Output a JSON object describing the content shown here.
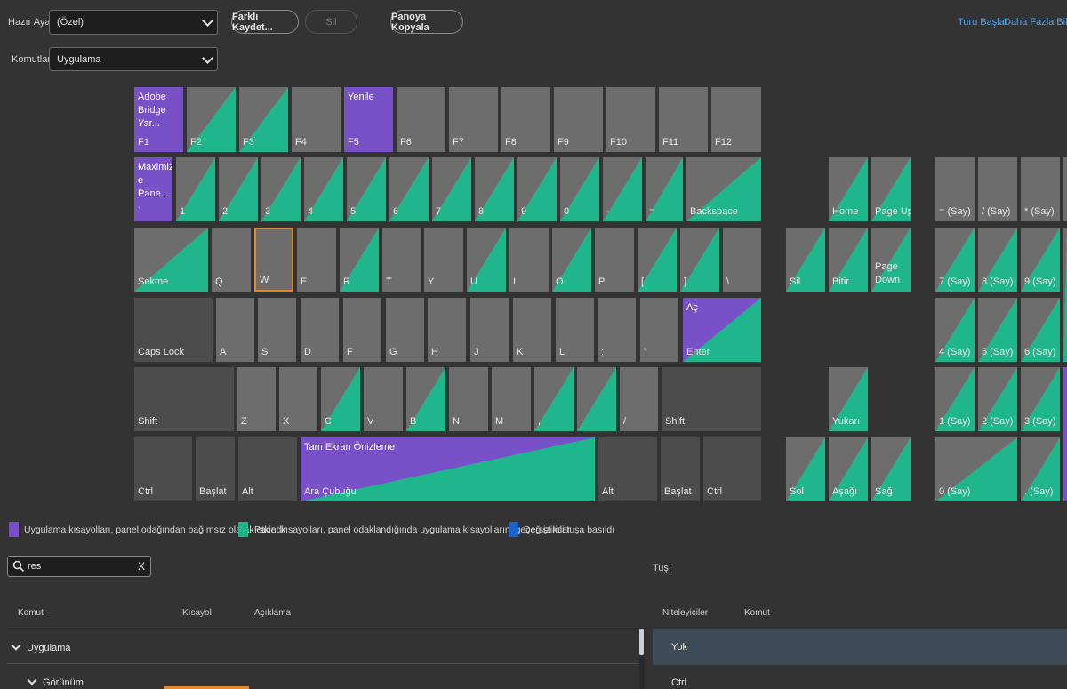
{
  "toolbar": {
    "preset_label": "Hazır Ayar:",
    "preset_value": "(Özel)",
    "save_as_label": "Farklı Kaydet...",
    "delete_label": "Sil",
    "copy_clipboard_label": "Panoya Kopyala",
    "commands_label": "Komutlar:",
    "commands_value": "Uygulama",
    "start_tour_label": "Turu Başlat",
    "more_info_label": "Daha Fazla Bilgi"
  },
  "keyboard": {
    "colors": {
      "app": "#7850c8",
      "panel": "#1fb68b",
      "modifier": "#1e64c8",
      "key": "#6d6d6d",
      "selected_border": "#e08a2e"
    },
    "keys": [
      {
        "id": "f1",
        "label": "F1",
        "top_label": "Adobe\nBridge Yar...",
        "type": "app"
      },
      {
        "id": "f2",
        "label": "F2",
        "type": "panel"
      },
      {
        "id": "f3",
        "label": "F3",
        "type": "panel"
      },
      {
        "id": "f4",
        "label": "F4",
        "type": "none"
      },
      {
        "id": "f5",
        "label": "F5",
        "top_label": "Yenile",
        "type": "app"
      },
      {
        "id": "f6",
        "label": "F6",
        "type": "none"
      },
      {
        "id": "f7",
        "label": "F7",
        "type": "none"
      },
      {
        "id": "f8",
        "label": "F8",
        "type": "none"
      },
      {
        "id": "f9",
        "label": "F9",
        "type": "none"
      },
      {
        "id": "f10",
        "label": "F10",
        "type": "none"
      },
      {
        "id": "f11",
        "label": "F11",
        "type": "none"
      },
      {
        "id": "f12",
        "label": "F12",
        "type": "none"
      },
      {
        "id": "backtick",
        "label": "`",
        "top_label": "Maximiz\ne Pane...",
        "type": "app"
      },
      {
        "id": "d1",
        "label": "1",
        "type": "panel"
      },
      {
        "id": "d2",
        "label": "2",
        "type": "panel"
      },
      {
        "id": "d3",
        "label": "3",
        "type": "panel"
      },
      {
        "id": "d4",
        "label": "4",
        "type": "panel"
      },
      {
        "id": "d5",
        "label": "5",
        "type": "panel"
      },
      {
        "id": "d6",
        "label": "6",
        "type": "panel"
      },
      {
        "id": "d7",
        "label": "7",
        "type": "panel"
      },
      {
        "id": "d8",
        "label": "8",
        "type": "panel"
      },
      {
        "id": "d9",
        "label": "9",
        "type": "panel"
      },
      {
        "id": "d0",
        "label": "0",
        "type": "panel"
      },
      {
        "id": "minus",
        "label": "-",
        "type": "panel"
      },
      {
        "id": "equals",
        "label": "=",
        "type": "panel"
      },
      {
        "id": "backspace",
        "label": "Backspace",
        "type": "panel"
      },
      {
        "id": "tab",
        "label": "Sekme",
        "type": "panel"
      },
      {
        "id": "q",
        "label": "Q",
        "type": "none"
      },
      {
        "id": "w",
        "label": "W",
        "type": "none",
        "selected": true
      },
      {
        "id": "e",
        "label": "E",
        "type": "none"
      },
      {
        "id": "r",
        "label": "R",
        "type": "panel"
      },
      {
        "id": "t",
        "label": "T",
        "type": "none"
      },
      {
        "id": "y",
        "label": "Y",
        "type": "none"
      },
      {
        "id": "u",
        "label": "U",
        "type": "panel"
      },
      {
        "id": "i",
        "label": "I",
        "type": "none"
      },
      {
        "id": "o",
        "label": "O",
        "type": "panel"
      },
      {
        "id": "p",
        "label": "P",
        "type": "none"
      },
      {
        "id": "lbracket",
        "label": "[",
        "type": "panel"
      },
      {
        "id": "rbracket",
        "label": "]",
        "type": "panel"
      },
      {
        "id": "backslash",
        "label": "\\",
        "type": "none"
      },
      {
        "id": "capslock",
        "label": "Caps Lock",
        "type": "dark"
      },
      {
        "id": "a",
        "label": "A",
        "type": "none"
      },
      {
        "id": "s",
        "label": "S",
        "type": "none"
      },
      {
        "id": "d",
        "label": "D",
        "type": "none"
      },
      {
        "id": "f",
        "label": "F",
        "type": "none"
      },
      {
        "id": "g",
        "label": "G",
        "type": "none"
      },
      {
        "id": "h",
        "label": "H",
        "type": "none"
      },
      {
        "id": "j",
        "label": "J",
        "type": "none"
      },
      {
        "id": "k",
        "label": "K",
        "type": "none"
      },
      {
        "id": "l",
        "label": "L",
        "type": "none"
      },
      {
        "id": "semicolon",
        "label": ";",
        "type": "none"
      },
      {
        "id": "quote",
        "label": "'",
        "type": "none"
      },
      {
        "id": "enter",
        "label": "Enter",
        "top_label": "Aç",
        "type": "both"
      },
      {
        "id": "lshift",
        "label": "Shift",
        "type": "dark"
      },
      {
        "id": "z",
        "label": "Z",
        "type": "none"
      },
      {
        "id": "x",
        "label": "X",
        "type": "none"
      },
      {
        "id": "c",
        "label": "C",
        "type": "panel"
      },
      {
        "id": "v",
        "label": "V",
        "type": "none"
      },
      {
        "id": "b",
        "label": "B",
        "type": "panel"
      },
      {
        "id": "n",
        "label": "N",
        "type": "none"
      },
      {
        "id": "m",
        "label": "M",
        "type": "none"
      },
      {
        "id": "comma",
        "label": ",",
        "type": "panel"
      },
      {
        "id": "period",
        "label": ".",
        "type": "panel"
      },
      {
        "id": "slash",
        "label": "/",
        "type": "none"
      },
      {
        "id": "rshift",
        "label": "Shift",
        "type": "dark"
      },
      {
        "id": "lctrl",
        "label": "Ctrl",
        "type": "dark"
      },
      {
        "id": "lstart",
        "label": "Başlat",
        "type": "dark"
      },
      {
        "id": "lalt",
        "label": "Alt",
        "type": "dark"
      },
      {
        "id": "space",
        "label": "Ara Çubuğu",
        "top_label": "Tam Ekran Önizleme",
        "type": "both"
      },
      {
        "id": "ralt",
        "label": "Alt",
        "type": "dark"
      },
      {
        "id": "rstart",
        "label": "Başlat",
        "type": "dark"
      },
      {
        "id": "rctrl",
        "label": "Ctrl",
        "type": "dark"
      },
      {
        "id": "home",
        "label": "Home",
        "type": "panel"
      },
      {
        "id": "pageup",
        "label": "Page Up",
        "type": "panel"
      },
      {
        "id": "del",
        "label": "Sil",
        "type": "panel"
      },
      {
        "id": "end",
        "label": "Bitir",
        "type": "panel"
      },
      {
        "id": "pagedown",
        "label": "Page\nDown",
        "type": "panel"
      },
      {
        "id": "up",
        "label": "Yukarı",
        "type": "panel"
      },
      {
        "id": "left",
        "label": "Sol",
        "type": "panel"
      },
      {
        "id": "down",
        "label": "Aşağı",
        "type": "panel"
      },
      {
        "id": "right",
        "label": "Sağ",
        "type": "panel"
      },
      {
        "id": "num_eq",
        "label": "= (Say)",
        "type": "none"
      },
      {
        "id": "num_div",
        "label": "/ (Say)",
        "type": "none"
      },
      {
        "id": "num_mul",
        "label": "* (Say)",
        "type": "none"
      },
      {
        "id": "num7",
        "label": "7 (Say)",
        "type": "panel"
      },
      {
        "id": "num8",
        "label": "8 (Say)",
        "type": "panel"
      },
      {
        "id": "num9",
        "label": "9 (Say)",
        "type": "panel"
      },
      {
        "id": "num4",
        "label": "4 (Say)",
        "type": "panel"
      },
      {
        "id": "num5",
        "label": "5 (Say)",
        "type": "panel"
      },
      {
        "id": "num6",
        "label": "6 (Say)",
        "type": "panel"
      },
      {
        "id": "num1",
        "label": "1 (Say)",
        "type": "panel"
      },
      {
        "id": "num2",
        "label": "2 (Say)",
        "type": "panel"
      },
      {
        "id": "num3",
        "label": "3 (Say)",
        "type": "panel"
      },
      {
        "id": "num0",
        "label": "0 (Say)",
        "type": "panel"
      },
      {
        "id": "numdot",
        "label": ". (Say)",
        "type": "panel"
      }
    ]
  },
  "legend": {
    "app_label": "Uygulama kısayolları, panel odağından bağımsız olarak etkindir",
    "panel_label": "Panel kısayolları, panel odaklandığında uygulama kısayollarını geçersiz kılar",
    "modifier_label": "Değiştirici tuşa basıldı"
  },
  "search": {
    "value": "res",
    "clear": "X"
  },
  "commands_table": {
    "headers": {
      "command": "Komut",
      "shortcut": "Kısayol",
      "description": "Açıklama"
    },
    "rows": [
      {
        "label": "Uygulama"
      },
      {
        "label": "Görünüm"
      }
    ]
  },
  "key_panel": {
    "title": "Tuş:",
    "headers": {
      "modifiers": "Niteleyiciler",
      "command": "Komut"
    },
    "rows": [
      {
        "label": "Yok"
      },
      {
        "label": "Ctrl"
      }
    ]
  }
}
